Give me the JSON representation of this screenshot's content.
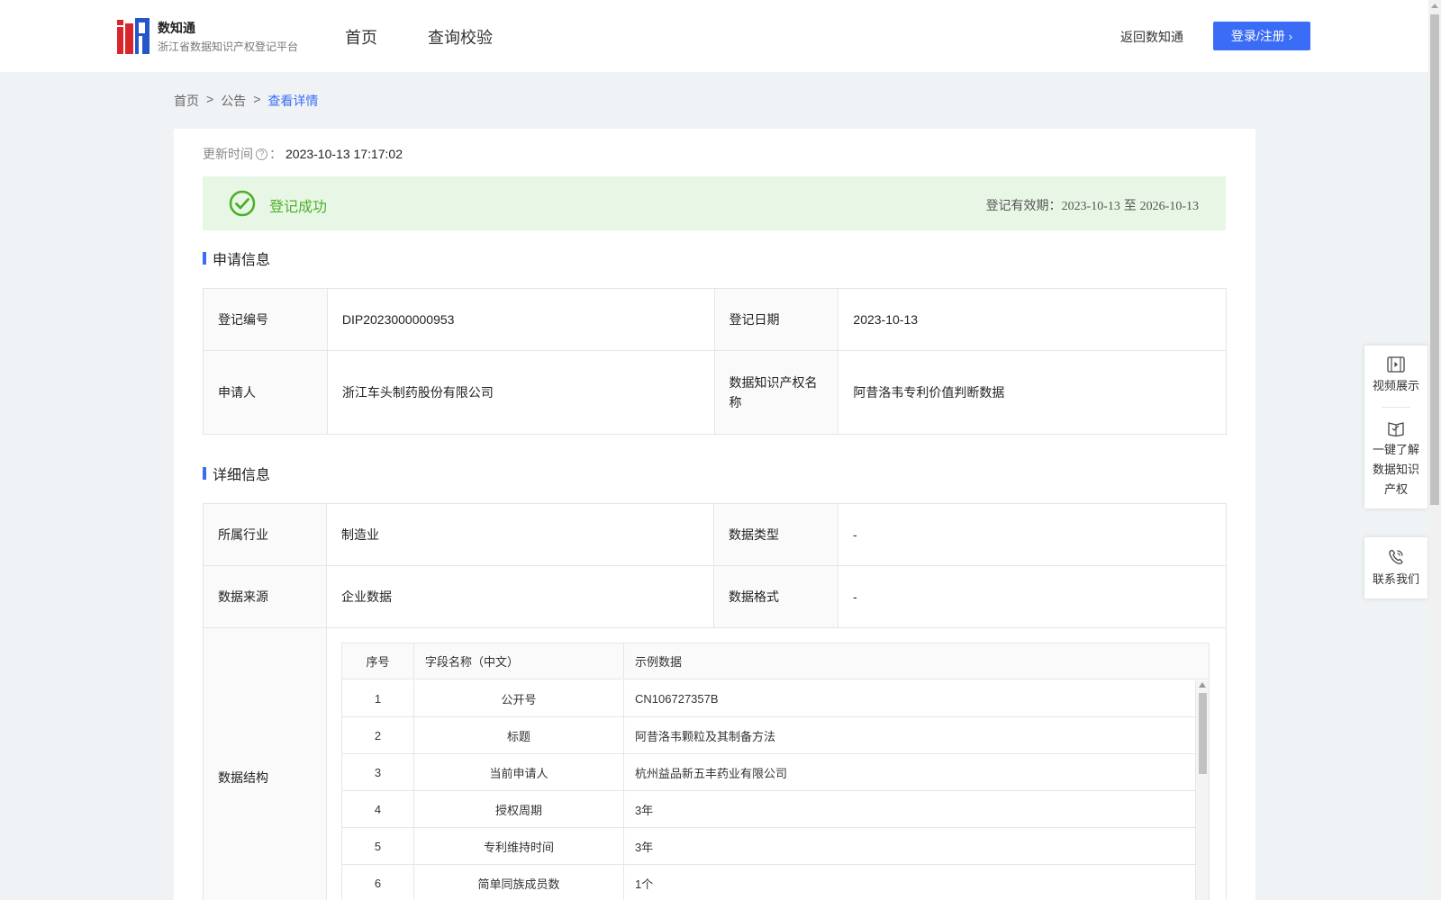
{
  "header": {
    "logo_title": "数知通",
    "logo_subtitle": "浙江省数据知识产权登记平台",
    "nav": {
      "home": "首页",
      "query": "查询校验"
    },
    "back_link": "返回数知通",
    "login_label": "登录/注册",
    "accent_color": "#3b6cf6",
    "logo_colors": {
      "red": "#d9262c",
      "blue": "#2456c9"
    }
  },
  "breadcrumb": {
    "items": [
      "首页",
      "公告"
    ],
    "separator": ">",
    "current": "查看详情"
  },
  "update": {
    "label": "更新时间",
    "help_icon": "question-circle-icon",
    "colon": "：",
    "value": "2023-10-13 17:17:02"
  },
  "status": {
    "icon": "check-circle-icon",
    "text": "登记成功",
    "color": "#4caf27",
    "validity_label": "登记有效期：",
    "validity_start": "2023-10-13",
    "validity_to": "至",
    "validity_end": "2026-10-13"
  },
  "sections": {
    "apply_info": "申请信息",
    "detail_info": "详细信息"
  },
  "apply_info": {
    "reg_no_label": "登记编号",
    "reg_no": "DIP2023000000953",
    "reg_date_label": "登记日期",
    "reg_date": "2023-10-13",
    "applicant_label": "申请人",
    "applicant": "浙江车头制药股份有限公司",
    "ip_name_label": "数据知识产权名称",
    "ip_name": "阿昔洛韦专利价值判断数据"
  },
  "detail_info": {
    "industry_label": "所属行业",
    "industry": "制造业",
    "data_type_label": "数据类型",
    "data_type": "-",
    "source_label": "数据来源",
    "source": "企业数据",
    "format_label": "数据格式",
    "format": "-",
    "structure_label": "数据结构"
  },
  "structure_table": {
    "headers": [
      "序号",
      "字段名称（中文）",
      "示例数据"
    ],
    "rows": [
      [
        "1",
        "公开号",
        "CN106727357B"
      ],
      [
        "2",
        "标题",
        "阿昔洛韦颗粒及其制备方法"
      ],
      [
        "3",
        "当前申请人",
        "杭州益品新五丰药业有限公司"
      ],
      [
        "4",
        "授权周期",
        "3年"
      ],
      [
        "5",
        "专利维持时间",
        "3年"
      ],
      [
        "6",
        "简单同族成员数",
        "1个"
      ]
    ]
  },
  "float_toolbar": {
    "video": {
      "icon": "video-icon",
      "label": "视频展示"
    },
    "learn": {
      "icon": "book-icon",
      "label": "一键了解数据知识产权"
    },
    "contact": {
      "icon": "phone-icon",
      "label": "联系我们"
    }
  }
}
